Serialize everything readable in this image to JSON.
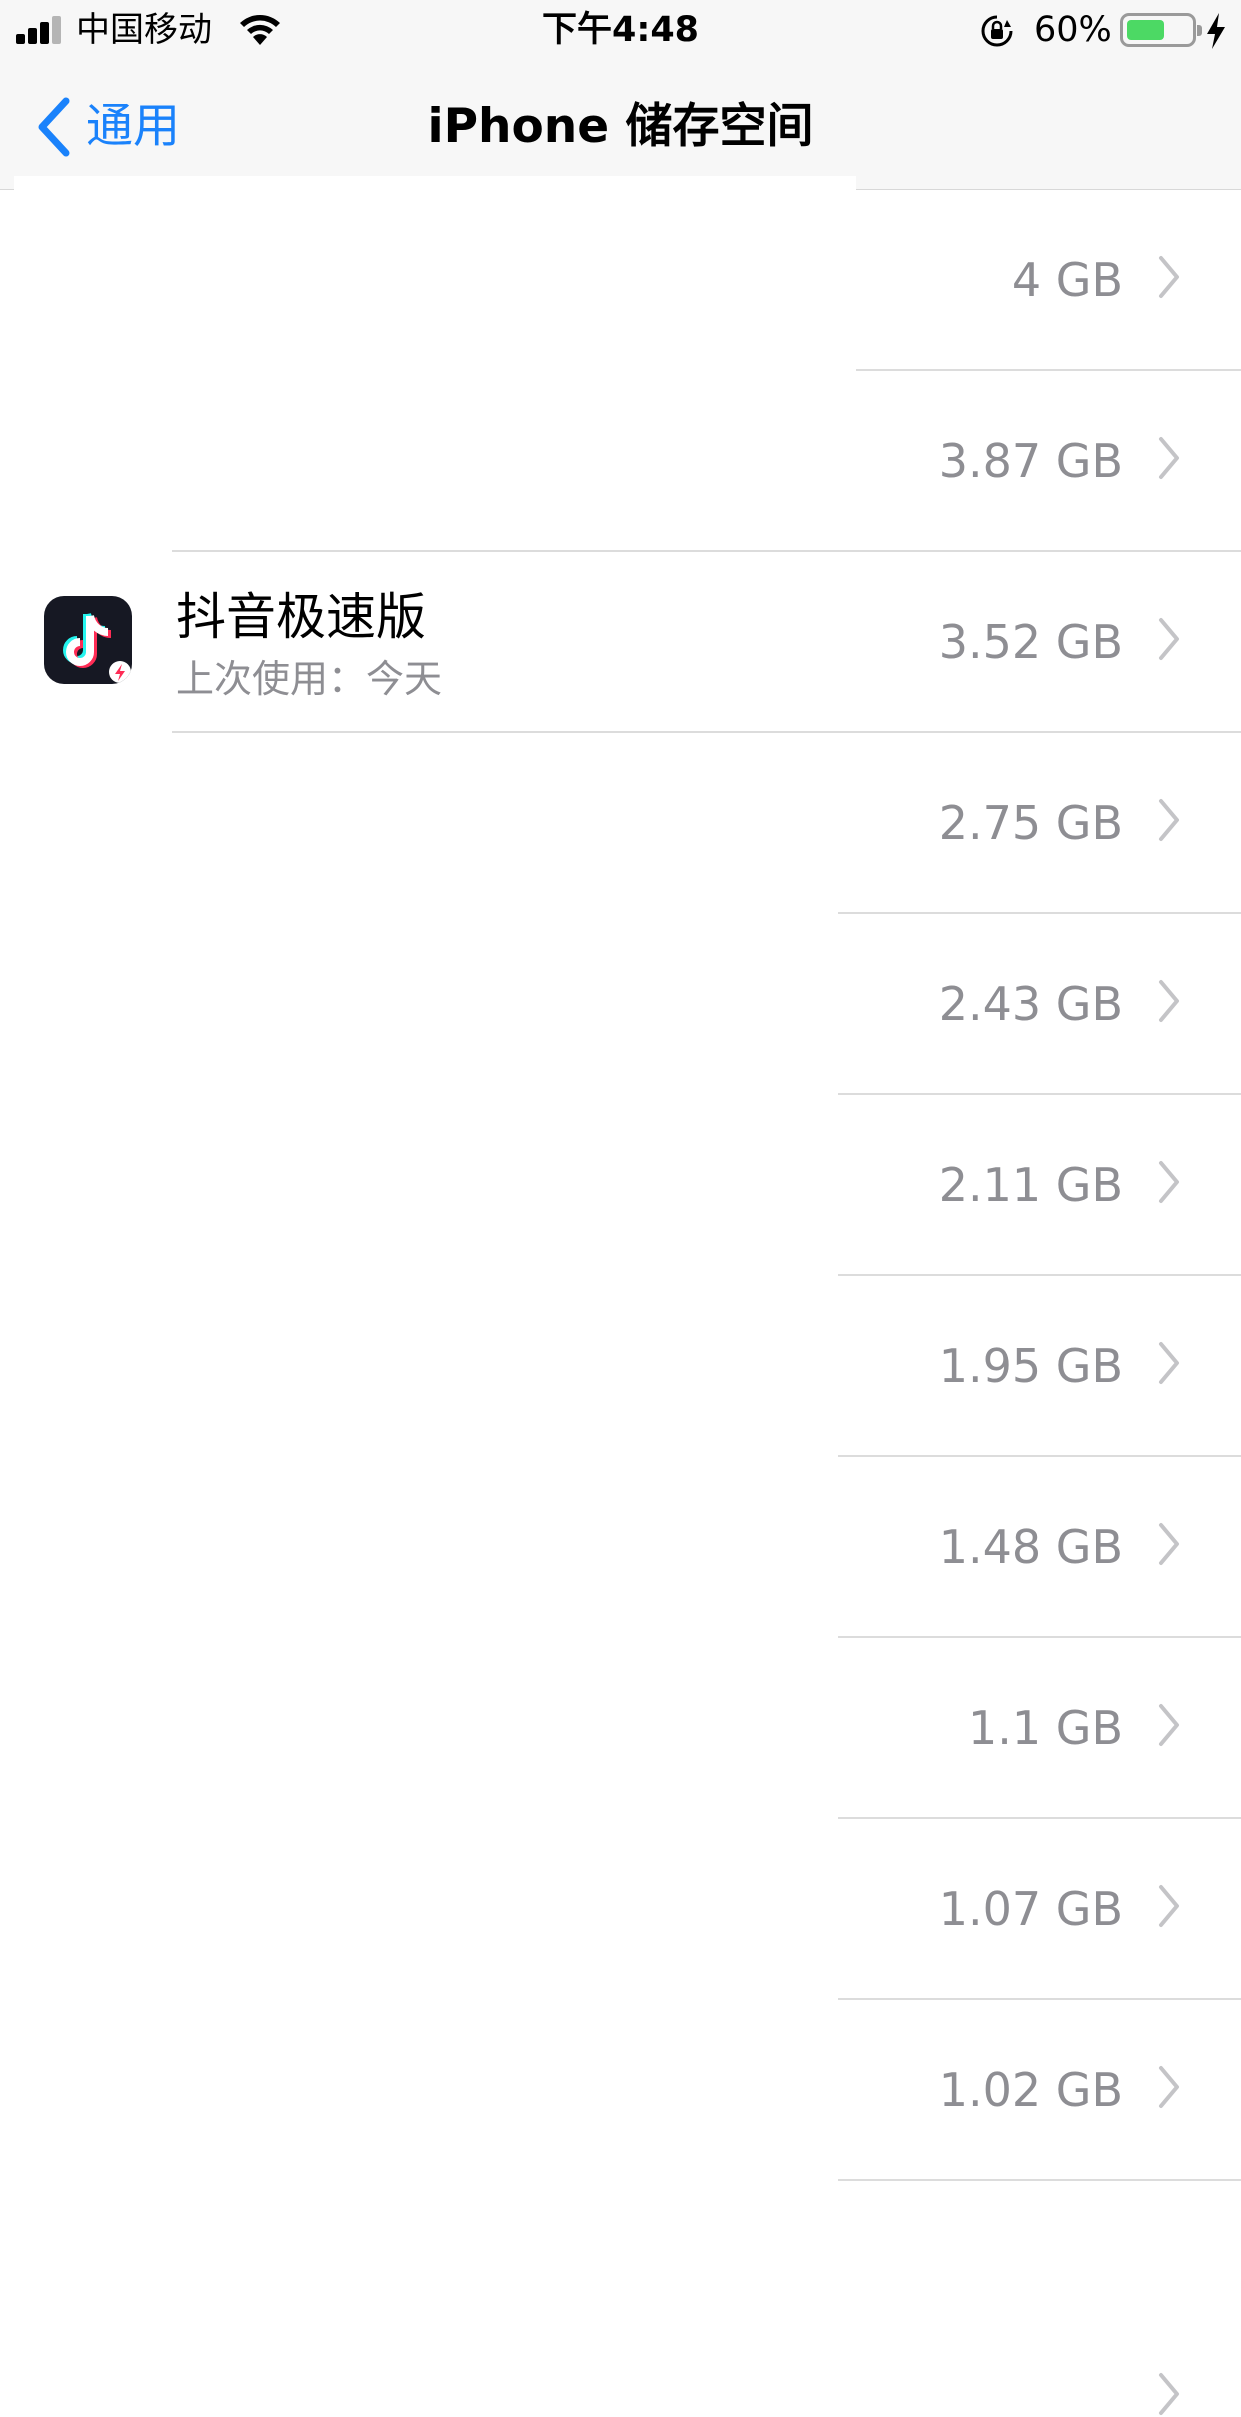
{
  "status_bar": {
    "carrier": "中国移动",
    "time": "下午4:48",
    "battery_percent_text": "60%",
    "battery_level": 0.6
  },
  "nav": {
    "back_label": "通用",
    "title": "iPhone 储存空间"
  },
  "colors": {
    "accent": "#1a82fb",
    "secondary_text": "#8e8e93",
    "battery_green": "#4cd964",
    "separator": "#dcdcdc"
  },
  "apps": [
    {
      "name": "",
      "subtitle": "",
      "size": "4 GB"
    },
    {
      "name": "",
      "subtitle": "",
      "size": "3.87 GB"
    },
    {
      "name": "抖音极速版",
      "subtitle": "上次使用：今天",
      "size": "3.52 GB",
      "icon": "douyin-lite-app-icon"
    },
    {
      "name": "",
      "subtitle": "",
      "size": "2.75 GB"
    },
    {
      "name": "",
      "subtitle": "",
      "size": "2.43 GB"
    },
    {
      "name": "",
      "subtitle": "",
      "size": "2.11 GB"
    },
    {
      "name": "",
      "subtitle": "",
      "size": "1.95 GB"
    },
    {
      "name": "",
      "subtitle": "",
      "size": "1.48 GB"
    },
    {
      "name": "",
      "subtitle": "",
      "size": "1.1 GB"
    },
    {
      "name": "",
      "subtitle": "",
      "size": "1.07 GB"
    },
    {
      "name": "",
      "subtitle": "",
      "size": "1.02 GB"
    }
  ]
}
